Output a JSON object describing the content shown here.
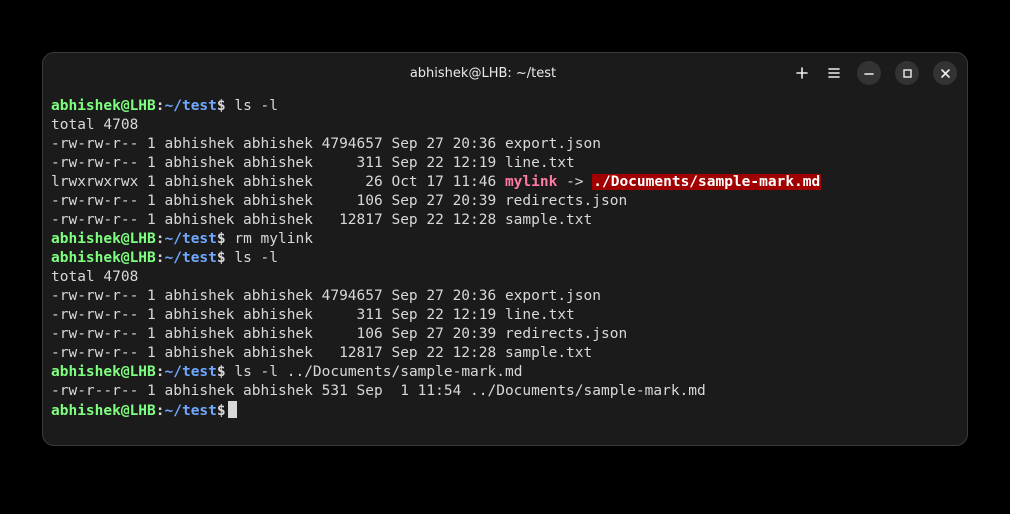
{
  "window": {
    "title": "abhishek@LHB: ~/test"
  },
  "prompt": {
    "user": "abhishek",
    "at": "@",
    "host": "LHB",
    "colon": ":",
    "path": "~/test",
    "dollar": "$"
  },
  "sessions": [
    {
      "command": " ls -l",
      "output_total": "total 4708",
      "rows": [
        {
          "perm": "-rw-rw-r--",
          "links": "1",
          "owner": "abhishek",
          "group": "abhishek",
          "size_pad": "4794657",
          "date": "Sep 27 20:36",
          "name": "export.json",
          "symlink": false
        },
        {
          "perm": "-rw-rw-r--",
          "links": "1",
          "owner": "abhishek",
          "group": "abhishek",
          "size_pad": "    311",
          "date": "Sep 22 12:19",
          "name": "line.txt",
          "symlink": false
        },
        {
          "perm": "lrwxrwxrwx",
          "links": "1",
          "owner": "abhishek",
          "group": "abhishek",
          "size_pad": "     26",
          "date": "Oct 17 11:46",
          "name": "mylink",
          "symlink": true,
          "arrow": " -> ",
          "target": "./Documents/sample-mark.md"
        },
        {
          "perm": "-rw-rw-r--",
          "links": "1",
          "owner": "abhishek",
          "group": "abhishek",
          "size_pad": "    106",
          "date": "Sep 27 20:39",
          "name": "redirects.json",
          "symlink": false
        },
        {
          "perm": "-rw-rw-r--",
          "links": "1",
          "owner": "abhishek",
          "group": "abhishek",
          "size_pad": "  12817",
          "date": "Sep 22 12:28",
          "name": "sample.txt",
          "symlink": false
        }
      ]
    },
    {
      "command": " rm mylink",
      "output_total": null,
      "rows": []
    },
    {
      "command": " ls -l",
      "output_total": "total 4708",
      "rows": [
        {
          "perm": "-rw-rw-r--",
          "links": "1",
          "owner": "abhishek",
          "group": "abhishek",
          "size_pad": "4794657",
          "date": "Sep 27 20:36",
          "name": "export.json",
          "symlink": false
        },
        {
          "perm": "-rw-rw-r--",
          "links": "1",
          "owner": "abhishek",
          "group": "abhishek",
          "size_pad": "    311",
          "date": "Sep 22 12:19",
          "name": "line.txt",
          "symlink": false
        },
        {
          "perm": "-rw-rw-r--",
          "links": "1",
          "owner": "abhishek",
          "group": "abhishek",
          "size_pad": "    106",
          "date": "Sep 27 20:39",
          "name": "redirects.json",
          "symlink": false
        },
        {
          "perm": "-rw-rw-r--",
          "links": "1",
          "owner": "abhishek",
          "group": "abhishek",
          "size_pad": "  12817",
          "date": "Sep 22 12:28",
          "name": "sample.txt",
          "symlink": false
        }
      ]
    },
    {
      "command": " ls -l ../Documents/sample-mark.md",
      "output_total": null,
      "rows": [
        {
          "perm": "-rw-r--r--",
          "links": "1",
          "owner": "abhishek",
          "group": "abhishek",
          "size_pad": "531",
          "date": "Sep  1 11:54",
          "name": "../Documents/sample-mark.md",
          "symlink": false
        }
      ]
    },
    {
      "command": "",
      "cursor": true
    }
  ]
}
